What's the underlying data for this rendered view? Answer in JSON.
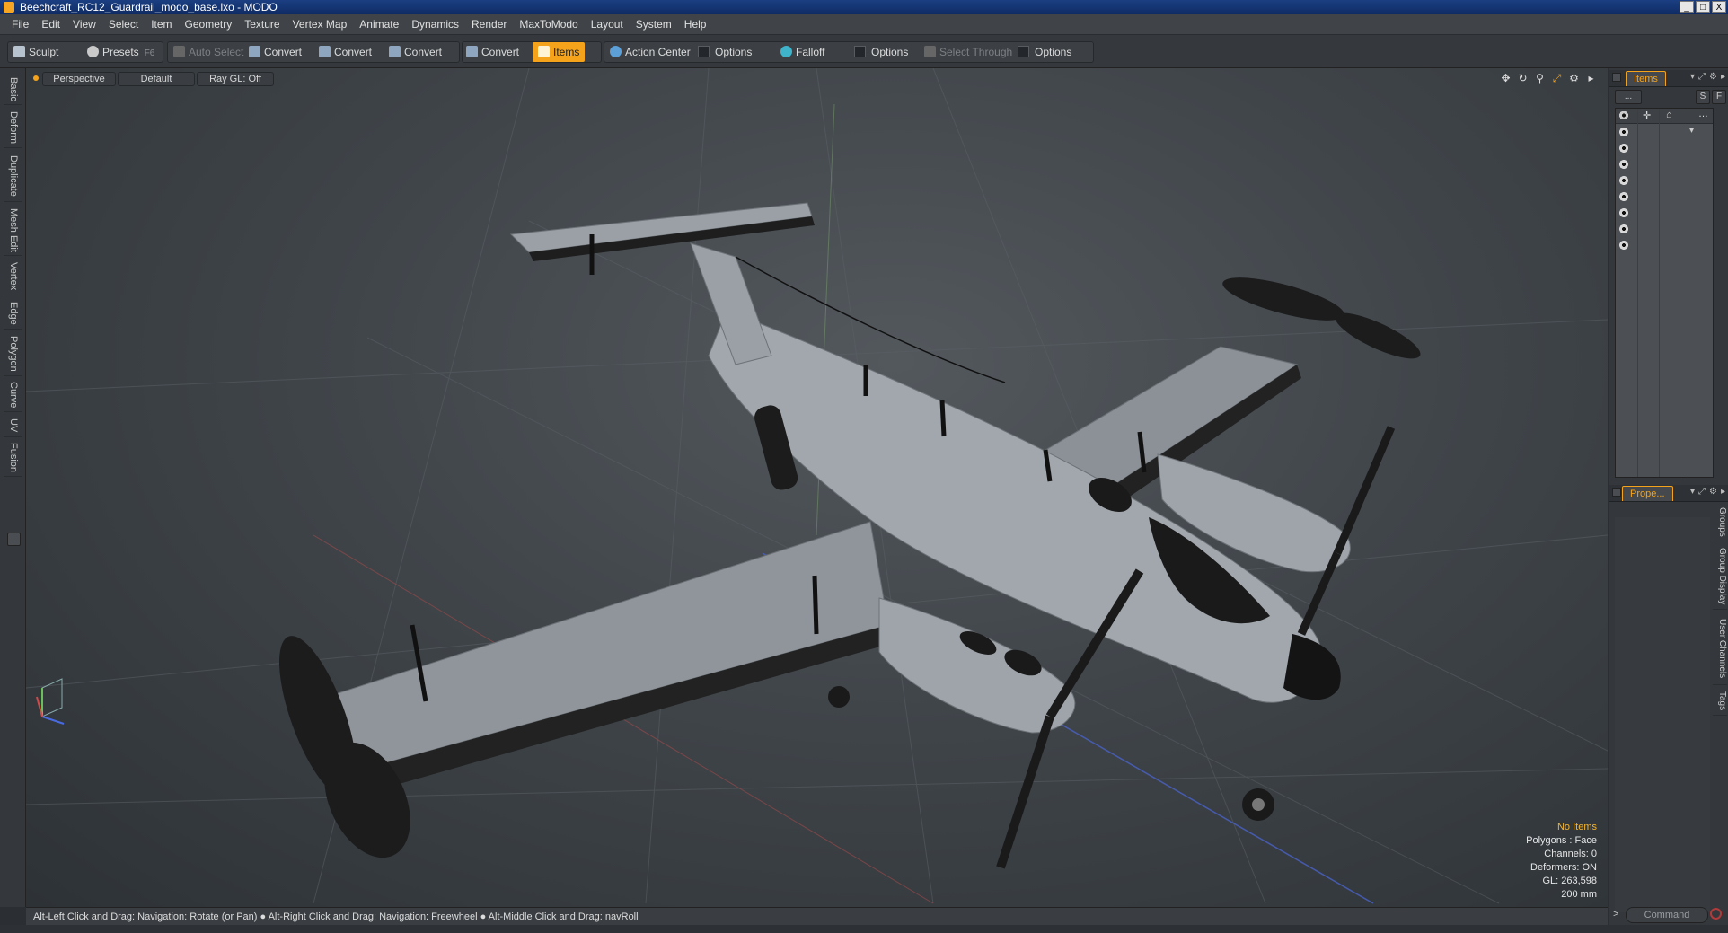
{
  "window": {
    "title": "Beechcraft_RC12_Guardrail_modo_base.lxo - MODO",
    "controls": [
      "_",
      "□",
      "X"
    ]
  },
  "menu": [
    "File",
    "Edit",
    "View",
    "Select",
    "Item",
    "Geometry",
    "Texture",
    "Vertex Map",
    "Animate",
    "Dynamics",
    "Render",
    "MaxToModo",
    "Layout",
    "System",
    "Help"
  ],
  "toolbar": {
    "sculpt": "Sculpt",
    "presets": "Presets",
    "presets_hotkey": "F6",
    "auto_select": "Auto Select",
    "convert1": "Convert",
    "convert2": "Convert",
    "convert3": "Convert",
    "convert4": "Convert",
    "items": "Items",
    "action_center": "Action Center",
    "options1": "Options",
    "falloff": "Falloff",
    "options2": "Options",
    "select_through": "Select Through",
    "options3": "Options"
  },
  "left_tabs": [
    "Basic",
    "Deform",
    "Duplicate",
    "Mesh Edit",
    "Vertex",
    "Edge",
    "Polygon",
    "Curve",
    "UV",
    "Fusion"
  ],
  "viewport": {
    "view": "Perspective",
    "shading": "Default",
    "raygl": "Ray GL: Off",
    "hud": {
      "items": "No Items",
      "polygons": "Polygons : Face",
      "channels": "Channels: 0",
      "deformers": "Deformers: ON",
      "gl": "GL: 263,598",
      "scale": "200 mm"
    }
  },
  "status": "Alt-Left Click and Drag: Navigation: Rotate (or Pan) ●  Alt-Right Click and Drag: Navigation: Freewheel ●  Alt-Middle Click and Drag: navRoll",
  "right_panel": {
    "items_tab": "Items",
    "filter_btn": "...",
    "s_btn": "S",
    "f_btn": "F",
    "properties_tab": "Prope...",
    "prop_tabs": [
      "Groups",
      "Group Display",
      "User Channels",
      "Tags"
    ],
    "command_placeholder": "Command"
  },
  "colors": {
    "accent": "#f5a31a",
    "titlebar": "#1b3f82",
    "viewport_bg": "#40454a"
  },
  "icons": {
    "scene_icons": [
      "move-icon",
      "rotate-icon",
      "zoom-icon",
      "fit-icon",
      "gear-icon",
      "expand-icon"
    ]
  }
}
